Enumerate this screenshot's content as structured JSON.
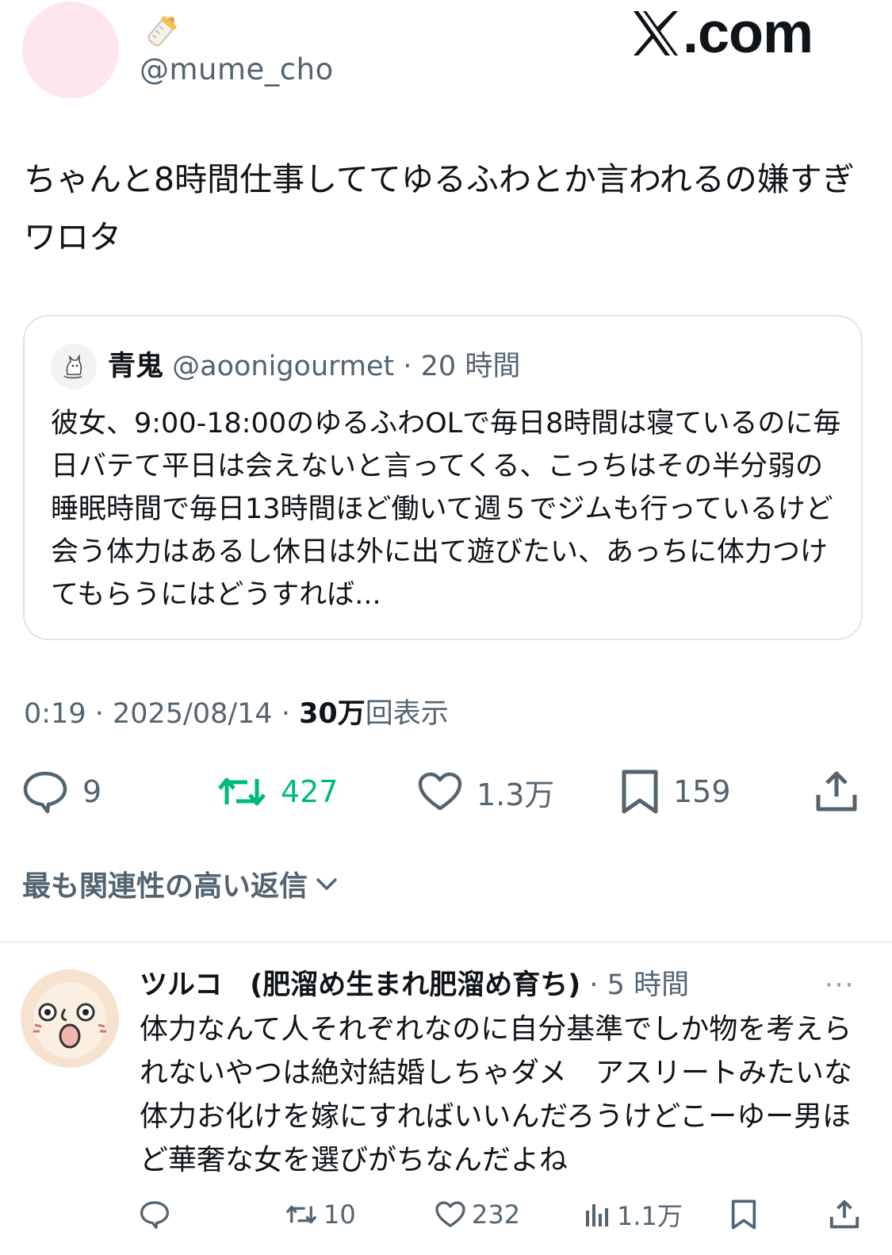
{
  "author": {
    "display_name_icon": "baby-bottle-icon",
    "handle": "@mume_cho"
  },
  "brand": {
    "logo_text": ".com"
  },
  "tweet": {
    "text": "ちゃんと8時間仕事しててゆるふわとか言われるの嫌すぎワロタ",
    "timestamp": "0:19 · 2025/08/14 · ",
    "views_value": "30万",
    "views_suffix": "回表示"
  },
  "quote": {
    "name": "青鬼",
    "handle_meta": "@aoonigourmet · 20 時間",
    "text": "彼女、9:00-18:00のゆるふわOLで毎日8時間は寝ているのに毎日バテて平日は会えないと言ってくる、こっちはその半分弱の睡眠時間で毎日13時間ほど働いて週５でジムも行っているけど会う体力はあるし休日は外に出て遊びたい、あっちに体力つけてもらうにはどうすれば..."
  },
  "actions": {
    "reply_count": "9",
    "repost_count": "427",
    "like_count": "1.3万",
    "bookmark_count": "159"
  },
  "colors": {
    "repost_active": "#00ba7c",
    "muted": "#536471"
  },
  "replies_sort": {
    "label": "最も関連性の高い返信"
  },
  "reply": {
    "name": "ツルコ　(肥溜め生まれ肥溜め育ち)",
    "meta": " · 5 時間",
    "more": "···",
    "text": "体力なんて人それぞれなのに自分基準でしか物を考えられないやつは絶対結婚しちゃダメ　アスリートみたいな体力お化けを嫁にすればいいんだろうけどこーゆー男ほど華奢な女を選びがちなんだよね",
    "repost_count": "10",
    "like_count": "232",
    "views_count": "1.1万"
  }
}
